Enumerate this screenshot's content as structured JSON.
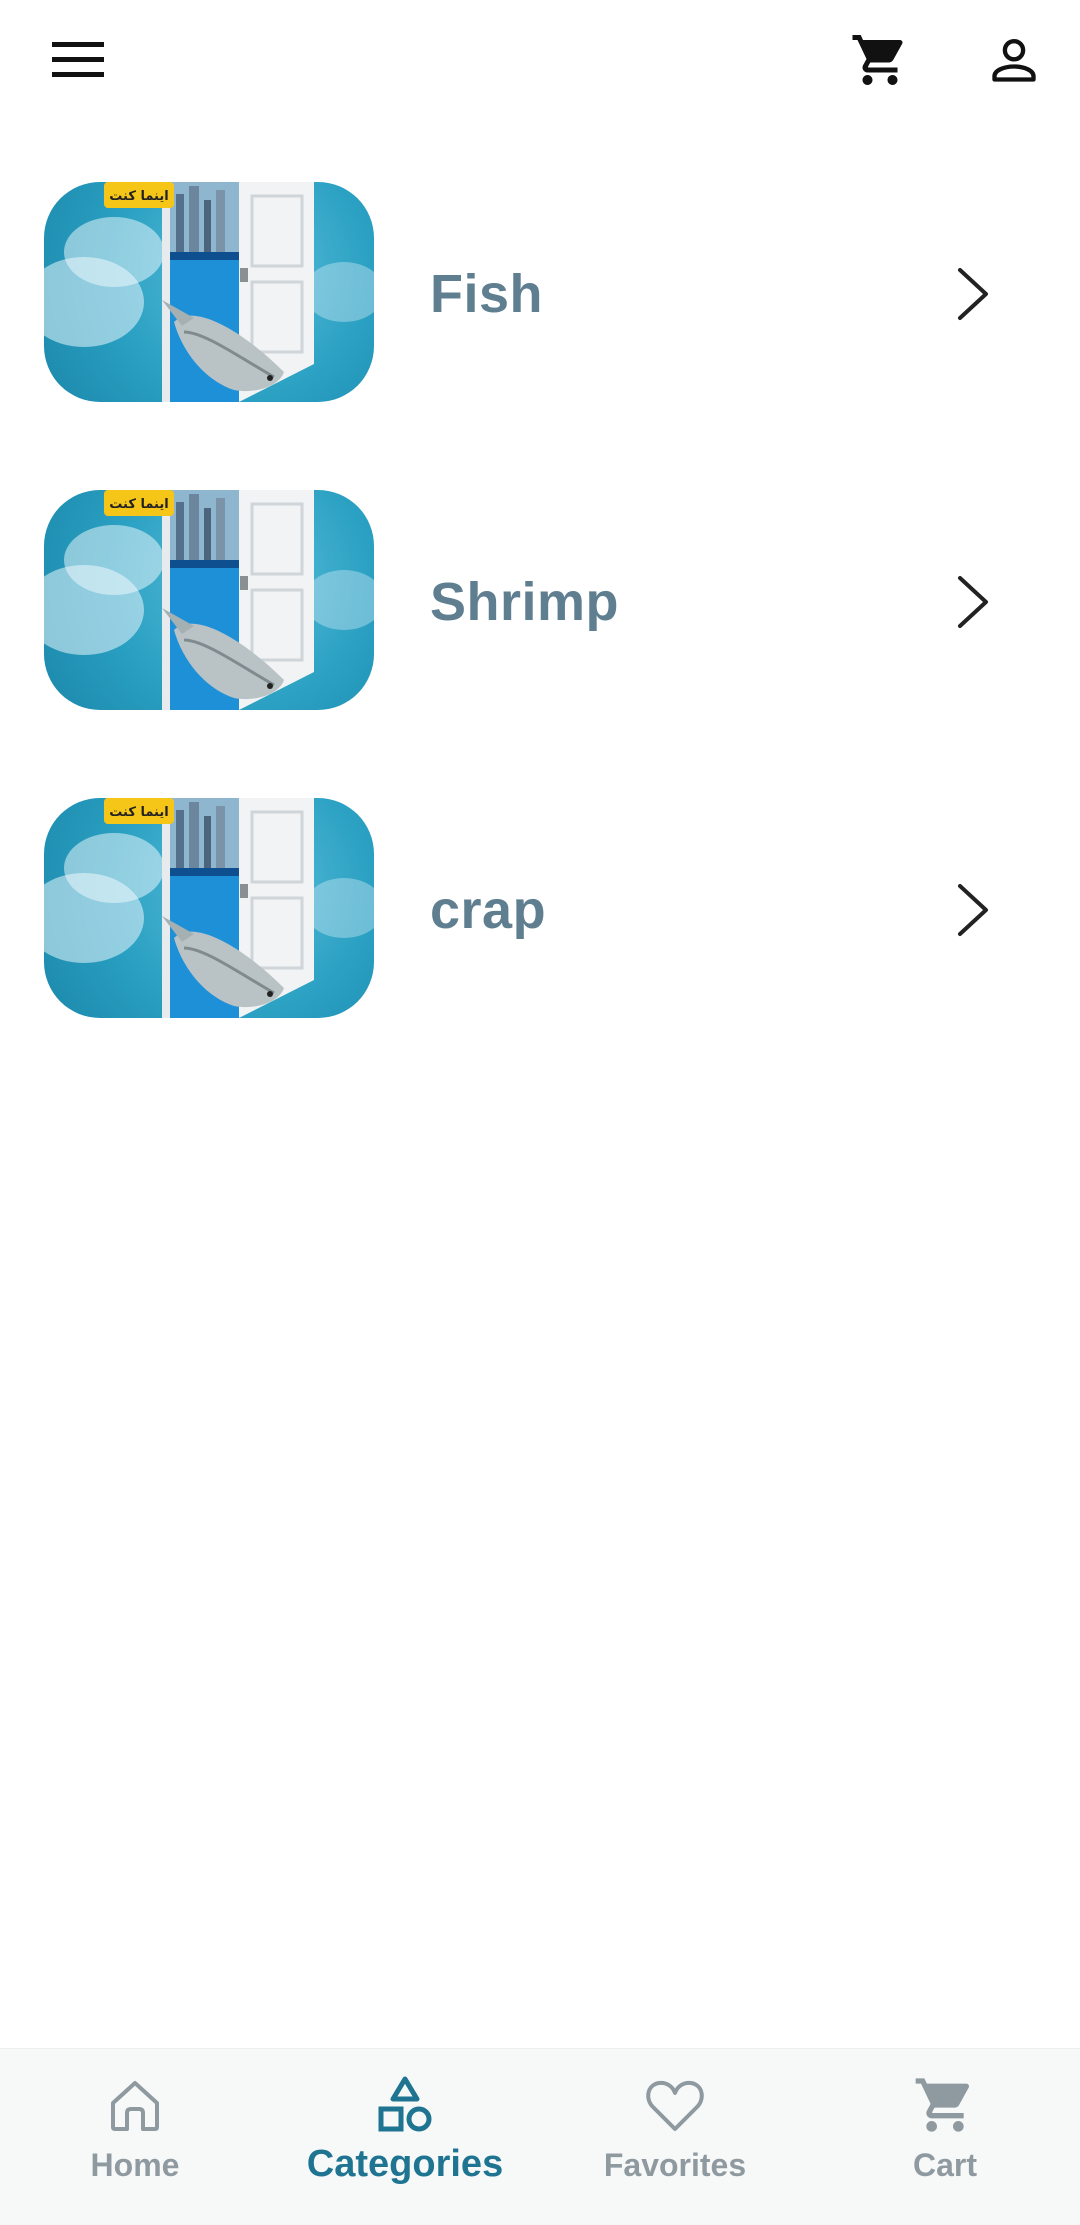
{
  "header": {
    "menu_icon": "hamburger-menu-icon",
    "cart_icon": "shopping-cart-icon",
    "profile_icon": "user-profile-icon"
  },
  "categories": [
    {
      "name": "Fish",
      "badge": "اینما کنت"
    },
    {
      "name": "Shrimp",
      "badge": "اینما کنت"
    },
    {
      "name": "crap",
      "badge": "اینما کنت"
    }
  ],
  "bottom_nav": {
    "items": [
      {
        "label": "Home",
        "icon": "home-icon"
      },
      {
        "label": "Categories",
        "icon": "shapes-icon",
        "active": true
      },
      {
        "label": "Favorites",
        "icon": "heart-icon"
      },
      {
        "label": "Cart",
        "icon": "shopping-cart-icon"
      }
    ]
  },
  "colors": {
    "accent": "#1f7591",
    "label": "#5f7f91",
    "inactive": "#8f9aa0"
  }
}
